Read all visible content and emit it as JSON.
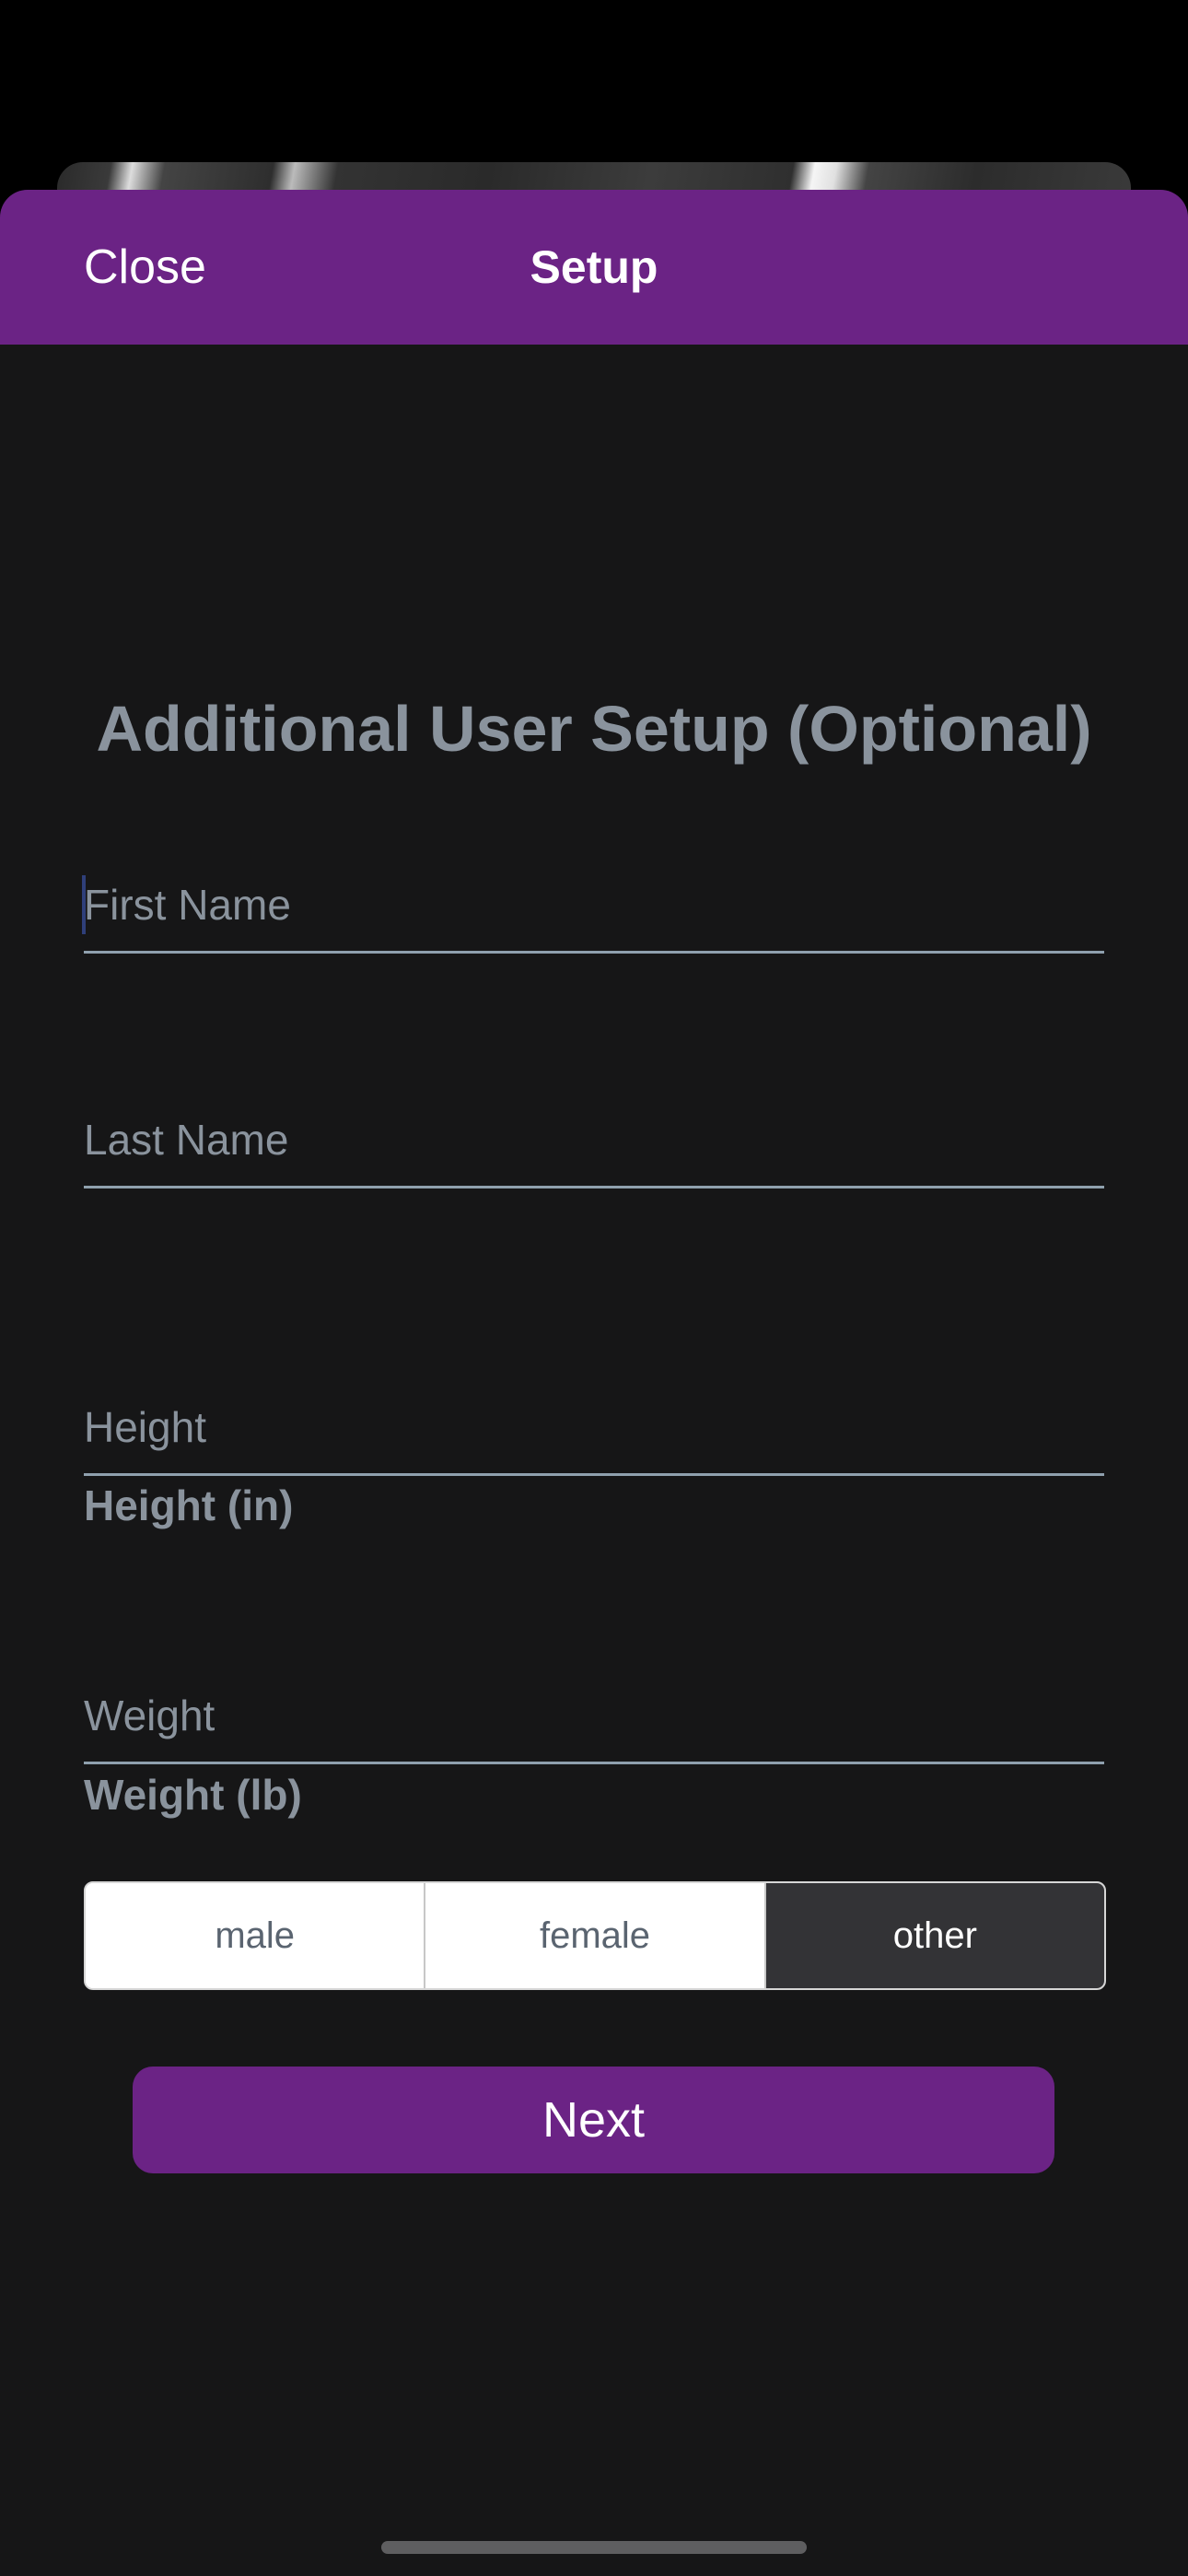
{
  "nav": {
    "close_label": "Close",
    "title": "Setup"
  },
  "form": {
    "heading": "Additional User Setup (Optional)",
    "first_name": {
      "placeholder": "First Name",
      "value": ""
    },
    "last_name": {
      "placeholder": "Last Name",
      "value": ""
    },
    "height": {
      "label": "Height (in)",
      "placeholder": "Height",
      "value": ""
    },
    "weight": {
      "label": "Weight (lb)",
      "placeholder": "Weight",
      "value": ""
    },
    "gender": {
      "options": [
        "male",
        "female",
        "other"
      ],
      "selected": "other"
    },
    "next_label": "Next"
  },
  "colors": {
    "accent": "#6b2385",
    "sheet_background": "#161617",
    "muted_text": "#8a939d",
    "segment_selected": "#333336"
  }
}
